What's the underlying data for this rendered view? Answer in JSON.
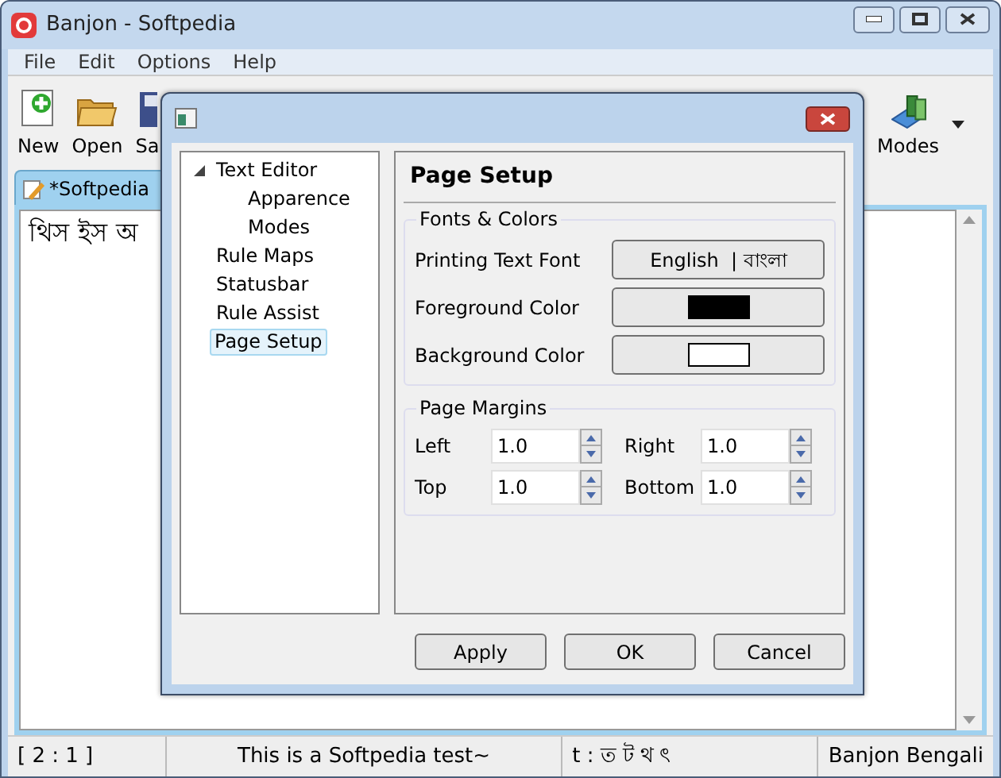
{
  "window": {
    "title": "Banjon - Softpedia"
  },
  "menu": [
    "File",
    "Edit",
    "Options",
    "Help"
  ],
  "toolbar": [
    {
      "label": "New",
      "kind": "new"
    },
    {
      "label": "Open",
      "kind": "open"
    },
    {
      "label": "Sa",
      "kind": "save"
    },
    {
      "label": "Modes",
      "kind": "modes"
    }
  ],
  "tabs": [
    {
      "label": "*Softpedia",
      "selected": true
    }
  ],
  "editor": {
    "text": "থিস ইস অ"
  },
  "status_bar": [
    "[ 2 : 1 ]",
    "This is a Softpedia test~",
    "t : ত ট থ ৎ",
    "Banjon Bengali"
  ],
  "dialog": {
    "tree": [
      {
        "label": "Text Editor",
        "expanded": true,
        "selected": false,
        "children": [
          {
            "label": "Apparence",
            "selected": false
          },
          {
            "label": "Modes",
            "selected": false
          }
        ]
      },
      {
        "label": "Rule Maps",
        "selected": false
      },
      {
        "label": "Statusbar",
        "selected": false
      },
      {
        "label": "Rule Assist",
        "selected": false
      },
      {
        "label": "Page Setup",
        "selected": true
      }
    ],
    "panel_title": "Page Setup",
    "fonts_colors": {
      "title": "Fonts & Colors",
      "rows": [
        {
          "label": "Printing Text Font",
          "kind": "font",
          "value": "English  | বাংলা"
        },
        {
          "label": "Foreground Color",
          "kind": "color",
          "color": "#000000"
        },
        {
          "label": "Background Color",
          "kind": "color",
          "color": "#ffffff"
        }
      ]
    },
    "page_margins": {
      "title": "Page Margins",
      "fields": [
        {
          "label": "Left",
          "value": "1.0"
        },
        {
          "label": "Right",
          "value": "1.0"
        },
        {
          "label": "Top",
          "value": "1.0"
        },
        {
          "label": "Bottom",
          "value": "1.0"
        }
      ]
    },
    "buttons": [
      "Apply",
      "OK",
      "Cancel"
    ]
  }
}
